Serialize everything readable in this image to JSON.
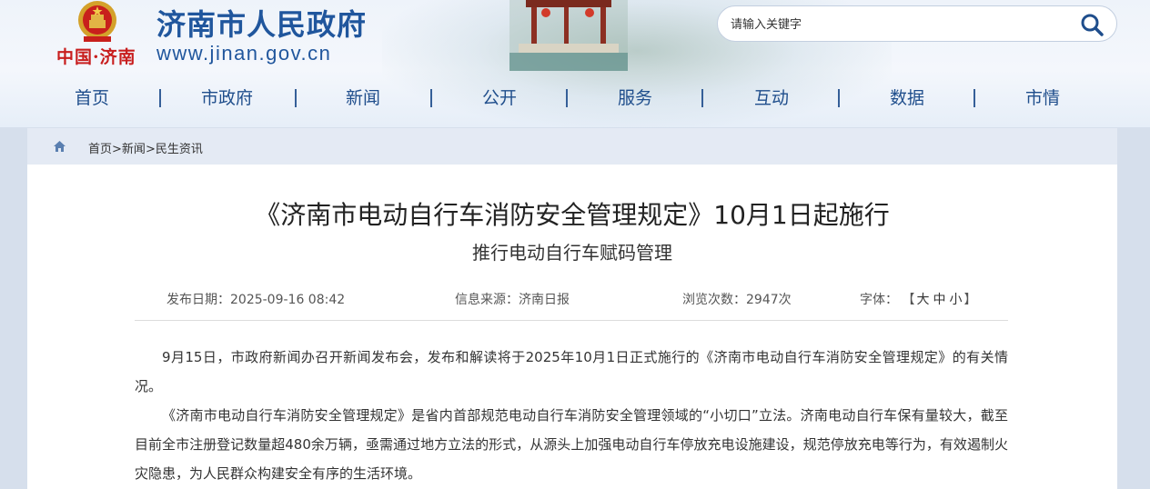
{
  "header": {
    "brand_cn": "中国·济南",
    "site_title": "济南市人民政府",
    "site_url": "www.jinan.gov.cn",
    "search_placeholder": "请输入关键字",
    "search_icon": "search-icon"
  },
  "nav": {
    "items": [
      "首页",
      "市政府",
      "新闻",
      "公开",
      "服务",
      "互动",
      "数据",
      "市情"
    ]
  },
  "breadcrumb": {
    "home_icon": "home-icon",
    "items": [
      "首页",
      "新闻",
      "民生资讯"
    ],
    "separator": ">"
  },
  "article": {
    "title": "《济南市电动自行车消防安全管理规定》10月1日起施行",
    "subtitle": "推行电动自行车赋码管理",
    "meta": {
      "date_label": "发布日期：",
      "date": "2025-09-16 08:42",
      "source_label": "信息来源：",
      "source": "济南日报",
      "views_label": "浏览次数：",
      "views": "2947次",
      "font_label": "字体：",
      "font_open": "【",
      "font_large": "大",
      "font_medium": "中",
      "font_small": "小",
      "font_close": "】"
    },
    "paragraphs": [
      "9月15日，市政府新闻办召开新闻发布会，发布和解读将于2025年10月1日正式施行的《济南市电动自行车消防安全管理规定》的有关情况。",
      "《济南市电动自行车消防安全管理规定》是省内首部规范电动自行车消防安全管理领域的“小切口”立法。济南电动自行车保有量较大，截至目前全市注册登记数量超480余万辆，亟需通过地方立法的形式，从源头上加强电动自行车停放充电设施建设，规范停放充电等行为，有效遏制火灾隐患，为人民群众构建安全有序的生活环境。"
    ]
  },
  "colors": {
    "brand_blue": "#20569d",
    "nav_blue": "#1f4e8c",
    "emblem_red": "#c81e1e",
    "page_bg": "#d6dfec"
  }
}
